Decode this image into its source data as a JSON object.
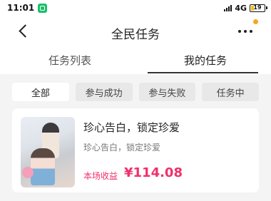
{
  "status_bar": {
    "time": "11:01",
    "network": "4G",
    "battery": "19"
  },
  "nav": {
    "title": "全民任务"
  },
  "main_tabs": [
    {
      "label": "任务列表",
      "active": false
    },
    {
      "label": "我的任务",
      "active": true
    }
  ],
  "filters": [
    {
      "label": "全部",
      "active": true
    },
    {
      "label": "参与成功",
      "active": false
    },
    {
      "label": "参与失败",
      "active": false
    },
    {
      "label": "任务中",
      "active": false
    }
  ],
  "task": {
    "title": "珍心告白，锁定珍爱",
    "subtitle": "珍心告白，锁定珍爱",
    "income_label": "本场收益",
    "income_value": "¥114.08"
  },
  "colors": {
    "accent": "#f0306a",
    "notif": "#1bbf6b",
    "badge_dot": "#f5a623"
  },
  "icons": [
    "back-arrow-icon",
    "more-dots-icon",
    "wechat-notification-icon",
    "signal-icon",
    "battery-icon"
  ]
}
